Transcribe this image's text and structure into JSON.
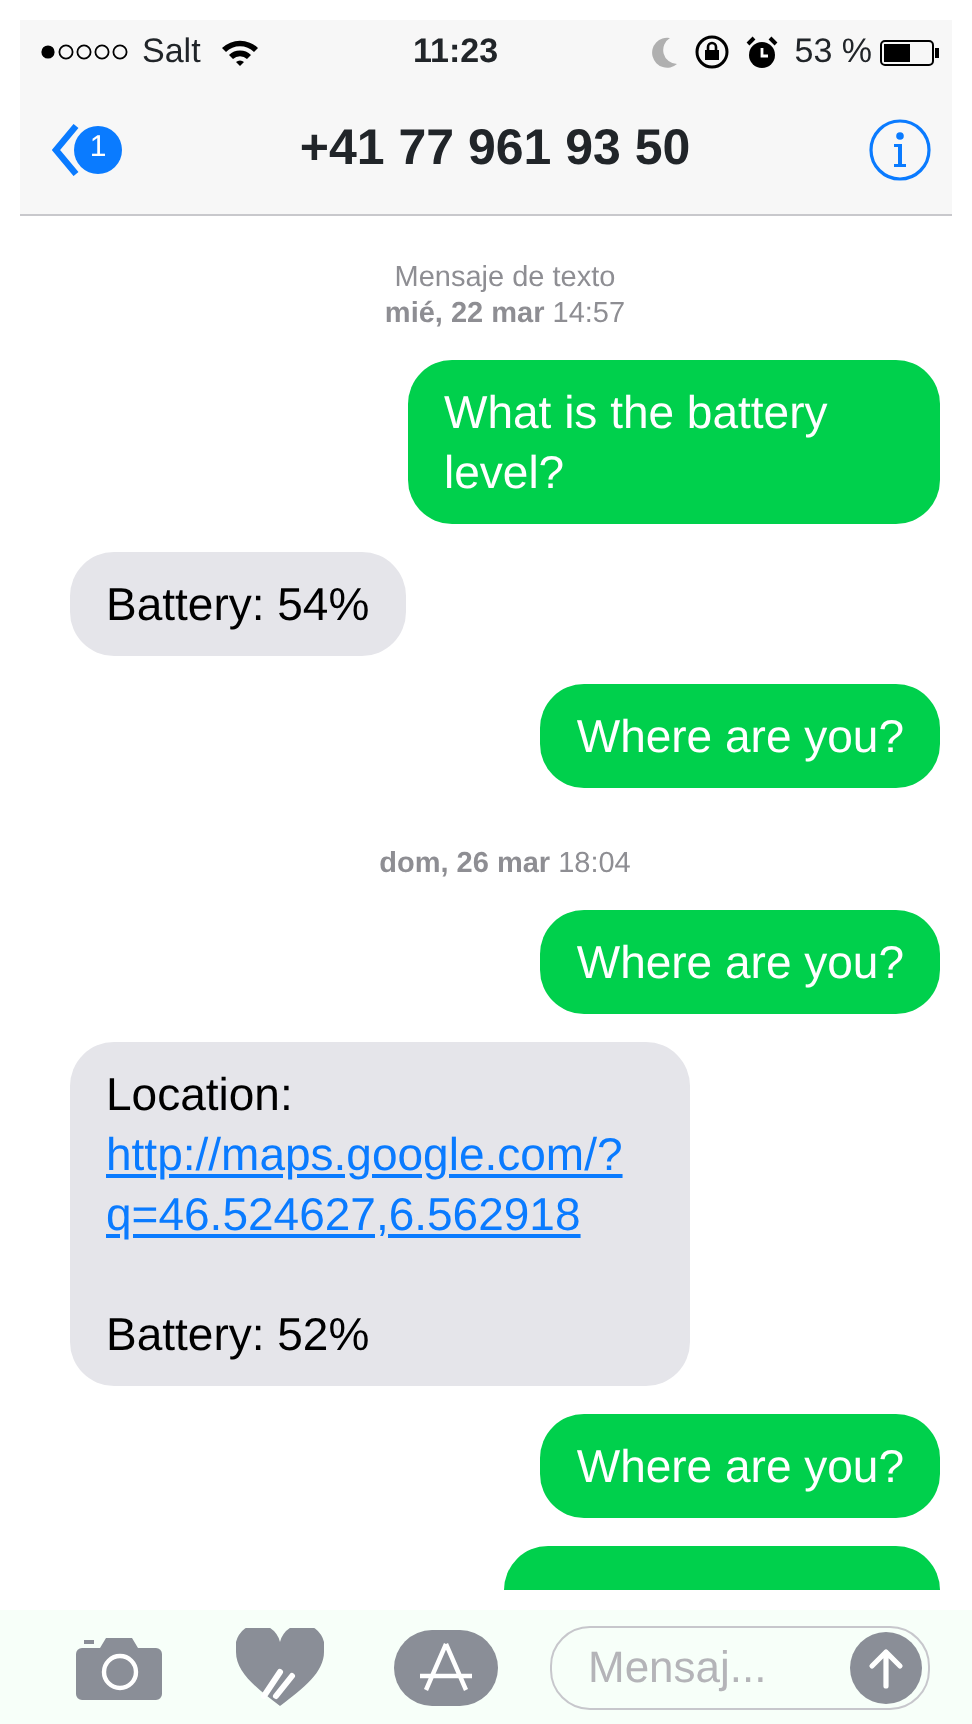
{
  "status_bar": {
    "carrier": "Salt",
    "time": "11:23",
    "battery_text": "53 %"
  },
  "nav": {
    "badge": "1",
    "title": "+41 77 961 93 50"
  },
  "messages": [
    {
      "kind": "timestamp",
      "lines": [
        "Mensaje de texto",
        "**mié, 22 mar** 14:57"
      ]
    },
    {
      "kind": "sent",
      "text": "What is the battery level?"
    },
    {
      "kind": "received",
      "text": "Battery: 54%"
    },
    {
      "kind": "sent",
      "text": "Where are you?"
    },
    {
      "kind": "timestamp",
      "lines": [
        "**dom, 26 mar** 18:04"
      ]
    },
    {
      "kind": "sent",
      "text": "Where are you?"
    },
    {
      "kind": "received_link",
      "label": "Location:",
      "link": "http://maps.google.com/?q=46.524627,6.562918",
      "after": "Battery: 52%"
    },
    {
      "kind": "sent",
      "text": "Where are you?"
    },
    {
      "kind": "partial"
    }
  ],
  "composer": {
    "placeholder": "Mensaj..."
  }
}
